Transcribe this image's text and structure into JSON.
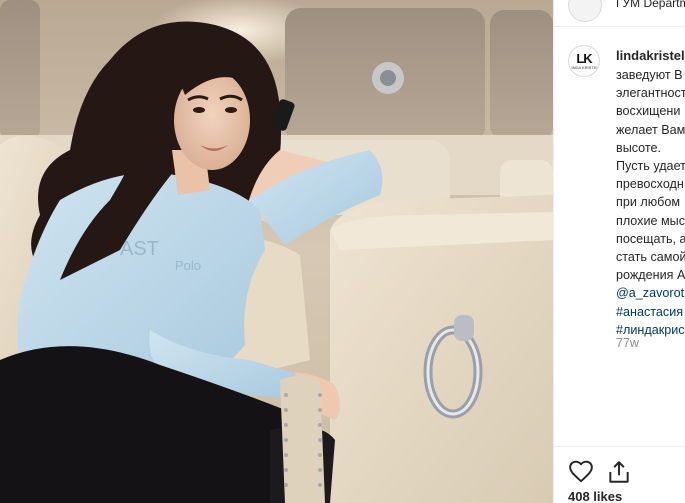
{
  "post": {
    "location": "ГУМ Department",
    "username": "lindakristel_",
    "avatar_logo": "LK",
    "avatar_sub": "LINDA KRISTEL",
    "caption_lines": [
      "заведуют В",
      "элегантност",
      "восхищени",
      "желает Вам",
      "высоте."
    ],
    "caption_lines_2": [
      "Пусть удает",
      "превосходн",
      "при любом",
      "плохие мыс",
      "посещать, а",
      "стать самой",
      "рождения А"
    ],
    "mention": "@a_zavorot",
    "hashtags": [
      "#анастасия",
      "#линдакрис"
    ],
    "timestamp": "77w",
    "likes": "408 likes"
  },
  "icons": {
    "like": "heart-outline-icon",
    "share": "share-upload-icon"
  }
}
